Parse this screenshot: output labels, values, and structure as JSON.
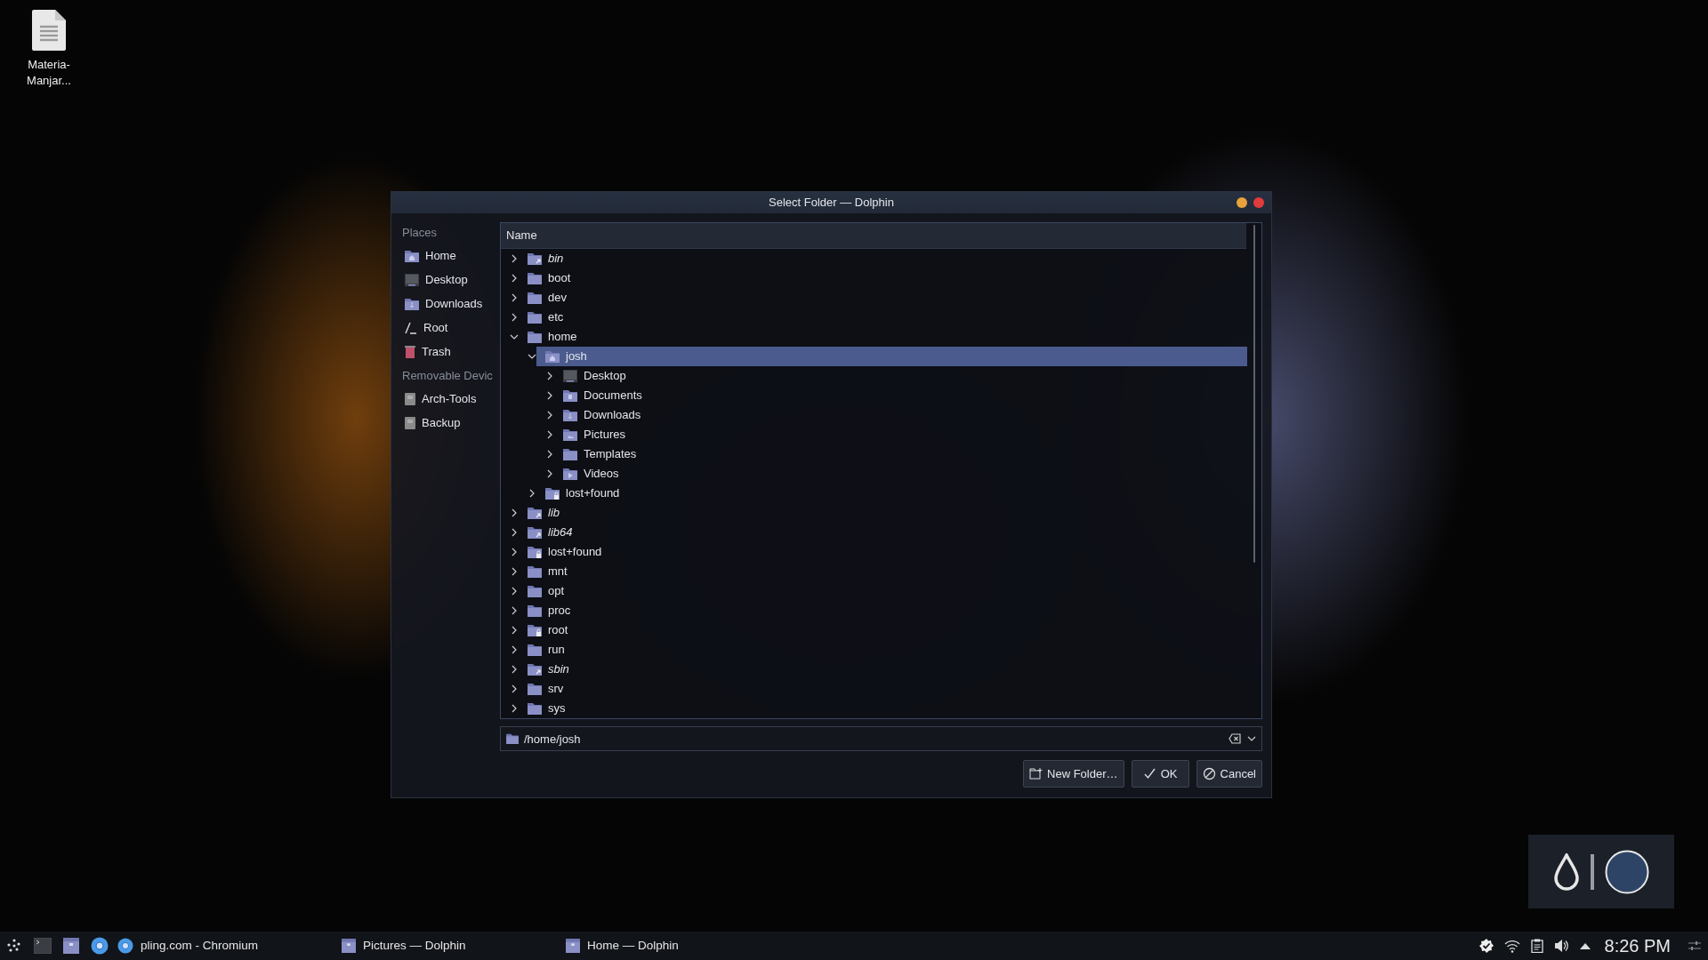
{
  "desktop": {
    "icons": [
      {
        "label": "Materia-Manjar..."
      }
    ]
  },
  "dialog": {
    "title": "Select Folder — Dolphin",
    "places": [
      {
        "heading": "Places",
        "items": [
          {
            "label": "Home",
            "kind": "home"
          },
          {
            "label": "Desktop",
            "kind": "desktop"
          },
          {
            "label": "Downloads",
            "kind": "downloads"
          },
          {
            "label": "Root",
            "kind": "root"
          },
          {
            "label": "Trash",
            "kind": "trash"
          }
        ]
      },
      {
        "heading": "Removable Devic",
        "items": [
          {
            "label": "Arch-Tools",
            "kind": "drive"
          },
          {
            "label": "Backup",
            "kind": "drive"
          }
        ]
      }
    ],
    "tree": {
      "column": "Name",
      "items": [
        {
          "label": "bin",
          "kind": "symlink",
          "expanded": false,
          "selected": false
        },
        {
          "label": "boot",
          "kind": "folder",
          "expanded": false,
          "selected": false
        },
        {
          "label": "dev",
          "kind": "folder",
          "expanded": false,
          "selected": false
        },
        {
          "label": "etc",
          "kind": "folder",
          "expanded": false,
          "selected": false
        },
        {
          "label": "home",
          "kind": "folder",
          "expanded": true,
          "selected": false,
          "children": [
            {
              "label": "josh",
              "kind": "home",
              "expanded": true,
              "selected": true,
              "children": [
                {
                  "label": "Desktop",
                  "kind": "desktop",
                  "expanded": false,
                  "selected": false
                },
                {
                  "label": "Documents",
                  "kind": "documents",
                  "expanded": false,
                  "selected": false
                },
                {
                  "label": "Downloads",
                  "kind": "downloads",
                  "expanded": false,
                  "selected": false
                },
                {
                  "label": "Pictures",
                  "kind": "pictures",
                  "expanded": false,
                  "selected": false
                },
                {
                  "label": "Templates",
                  "kind": "folder",
                  "expanded": false,
                  "selected": false
                },
                {
                  "label": "Videos",
                  "kind": "videos",
                  "expanded": false,
                  "selected": false
                }
              ]
            },
            {
              "label": "lost+found",
              "kind": "locked",
              "expanded": false,
              "selected": false
            }
          ]
        },
        {
          "label": "lib",
          "kind": "symlink",
          "expanded": false,
          "selected": false
        },
        {
          "label": "lib64",
          "kind": "symlink",
          "expanded": false,
          "selected": false
        },
        {
          "label": "lost+found",
          "kind": "locked",
          "expanded": false,
          "selected": false
        },
        {
          "label": "mnt",
          "kind": "folder",
          "expanded": false,
          "selected": false
        },
        {
          "label": "opt",
          "kind": "folder",
          "expanded": false,
          "selected": false
        },
        {
          "label": "proc",
          "kind": "folder",
          "expanded": false,
          "selected": false
        },
        {
          "label": "root",
          "kind": "locked",
          "expanded": false,
          "selected": false
        },
        {
          "label": "run",
          "kind": "folder",
          "expanded": false,
          "selected": false
        },
        {
          "label": "sbin",
          "kind": "symlink",
          "expanded": false,
          "selected": false
        },
        {
          "label": "srv",
          "kind": "folder",
          "expanded": false,
          "selected": false
        },
        {
          "label": "sys",
          "kind": "folder",
          "expanded": false,
          "selected": false
        }
      ]
    },
    "location": "/home/josh",
    "buttons": [
      {
        "label": "New Folder…",
        "kind": "new-folder"
      },
      {
        "label": "OK",
        "kind": "ok"
      },
      {
        "label": "Cancel",
        "kind": "cancel"
      }
    ]
  },
  "taskbar": {
    "tasks": [
      {
        "label": "pling.com - Chromium",
        "kind": "browser"
      },
      {
        "label": "Pictures — Dolphin",
        "kind": "file-manager"
      },
      {
        "label": "Home — Dolphin",
        "kind": "file-manager"
      }
    ],
    "clock": "8:26 PM"
  }
}
